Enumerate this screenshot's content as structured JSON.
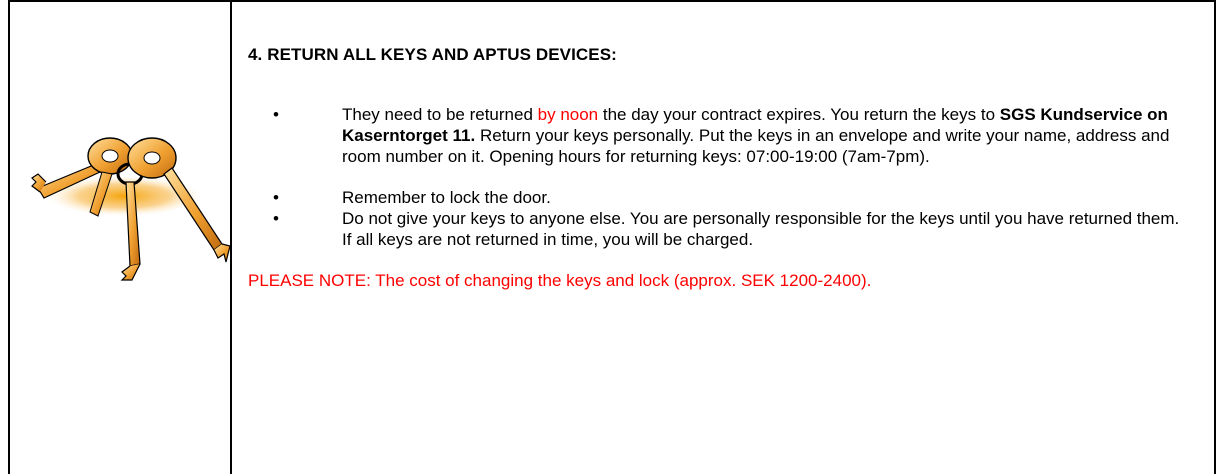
{
  "image": {
    "icon": "keys-clipart",
    "colors": {
      "key": "#f0a030",
      "key_highlight": "#ffd890",
      "outline": "#000000",
      "glow": "#f5a000"
    }
  },
  "section": {
    "heading": "4. RETURN ALL KEYS AND APTUS DEVICES:",
    "items": [
      {
        "p1": "They need to be returned ",
        "red": "by noon",
        "p2": " the day your contract expires. You return the keys to ",
        "bold": "SGS Kundservice on Kaserntorget 11.",
        "p3": " Return your keys personally. Put the keys in an envelope and write your name, address and room number on it. Opening hours for returning keys: 07:00-19:00 (7am-7pm)."
      },
      {
        "text": "Remember to lock the door."
      },
      {
        "text": "Do not give your keys to anyone else. You are personally responsible for the keys until you have returned them. If all keys are not returned in time, you will be charged."
      }
    ],
    "note": "PLEASE NOTE: The cost of changing the keys and lock (approx. SEK 1200-2400)."
  },
  "colors": {
    "accent": "#ff0000",
    "border": "#000000"
  }
}
